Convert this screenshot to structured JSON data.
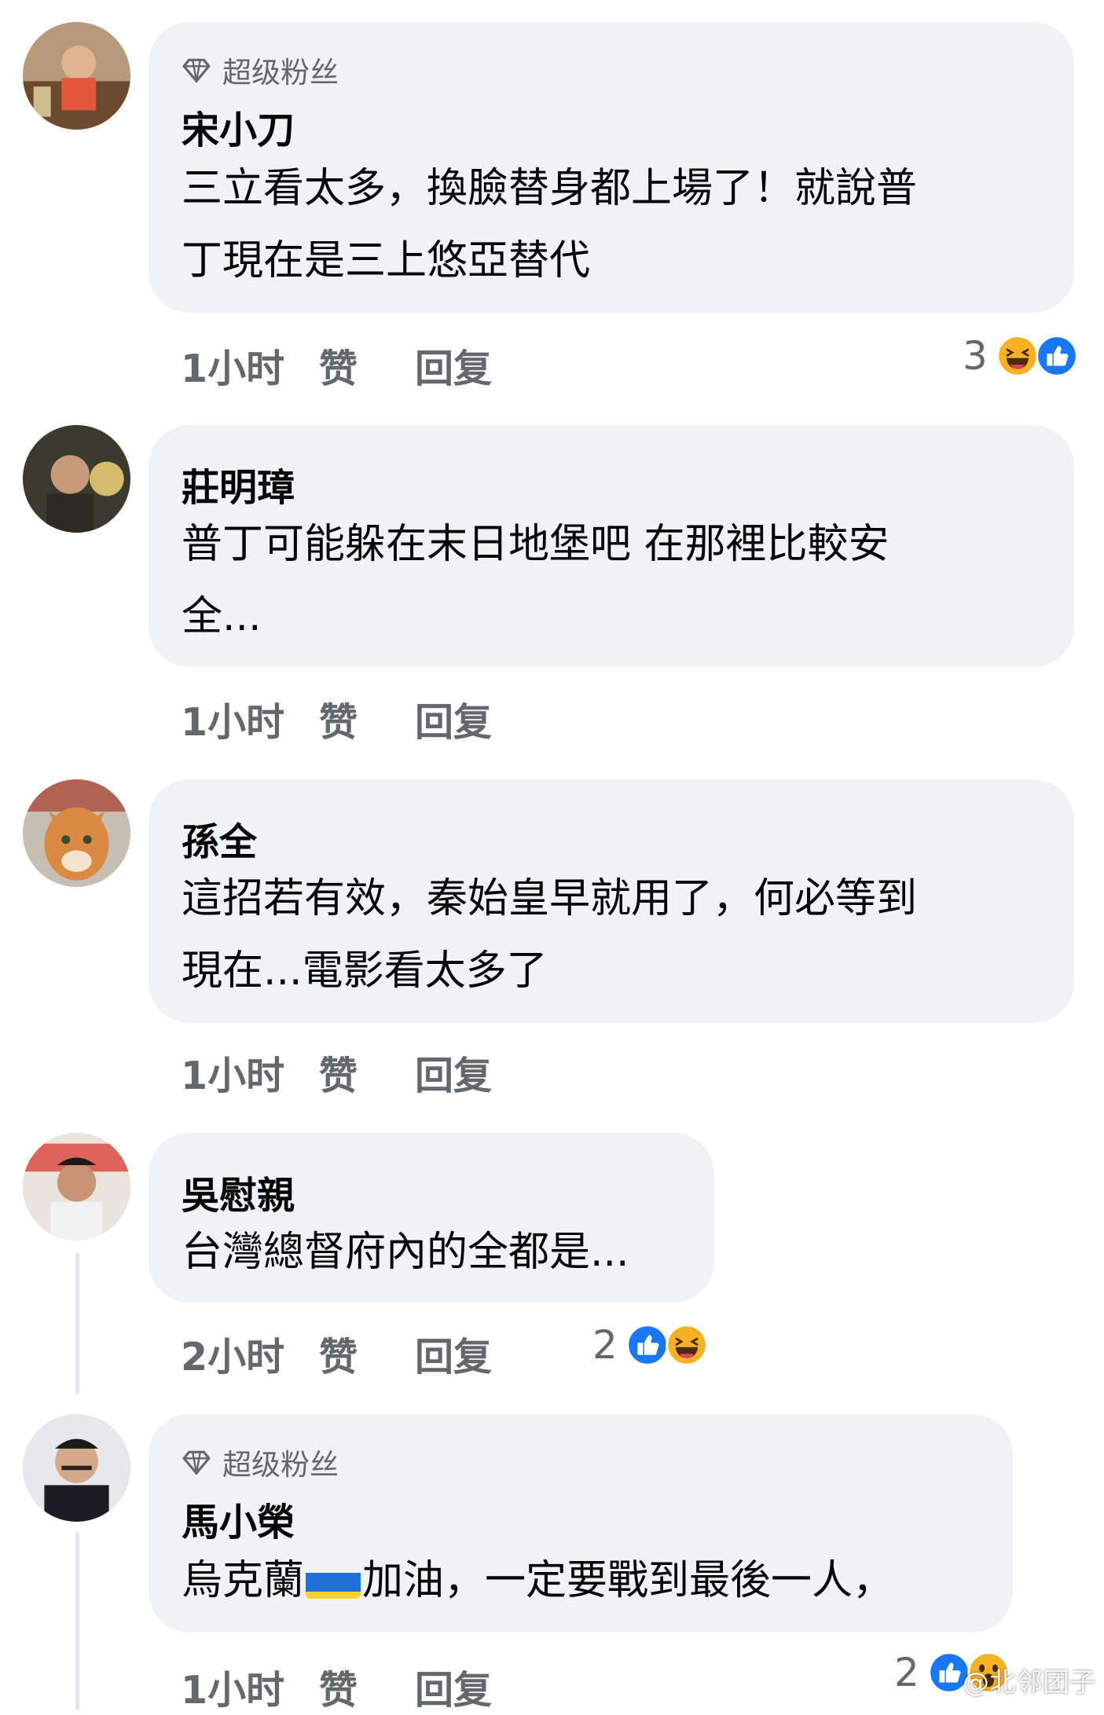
{
  "comments": [
    {
      "badge": "超级粉丝",
      "author": "宋小刀",
      "lines": [
        "三立看太多，換臉替身都上場了！就說普",
        "丁現在是三上悠亞替代"
      ],
      "time": "1小时",
      "like": "赞",
      "reply": "回复",
      "reaction_count": "3",
      "reactions": [
        "haha-icon",
        "like-icon"
      ]
    },
    {
      "author": "莊明璋",
      "lines": [
        "普丁可能躲在末日地堡吧 在那裡比較安",
        "全..."
      ],
      "time": "1小时",
      "like": "赞",
      "reply": "回复"
    },
    {
      "author": "孫全",
      "lines": [
        "這招若有效，秦始皇早就用了，何必等到",
        "現在...電影看太多了"
      ],
      "time": "1小时",
      "like": "赞",
      "reply": "回复"
    },
    {
      "author": "吳慰親",
      "lines": [
        "台灣總督府內的全都是..."
      ],
      "time": "2小时",
      "like": "赞",
      "reply": "回复",
      "reaction_count": "2",
      "reactions": [
        "like-icon",
        "haha-icon"
      ]
    },
    {
      "badge": "超级粉丝",
      "author": "馬小榮",
      "line_before_flag": "烏克蘭",
      "line_after_flag": "加油，一定要戰到最後一人，",
      "time": "1小时",
      "like": "赞",
      "reply": "回复",
      "reaction_count": "2",
      "reactions": [
        "like-icon",
        "wow-icon"
      ]
    }
  ],
  "watermark": "@北邻团子",
  "colors": {
    "bubble": "#f0f2f5",
    "meta_text": "#65676b",
    "like_blue": "#1877f2",
    "reaction_yellow": "#f7b125"
  }
}
